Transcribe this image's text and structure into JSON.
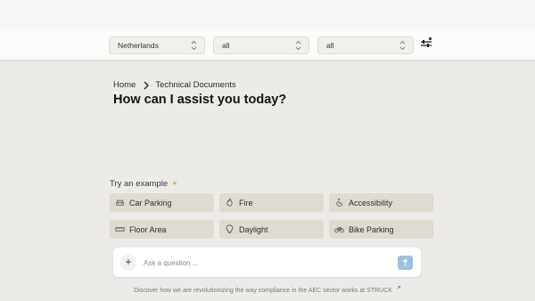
{
  "filters": {
    "country": "Netherlands",
    "filter2": "all",
    "filter3": "all"
  },
  "breadcrumb": {
    "home": "Home",
    "current": "Technical Documents"
  },
  "heading": "How can I assist you today?",
  "examples": {
    "label": "Try an example",
    "items": [
      {
        "label": "Car Parking",
        "icon": "car-icon"
      },
      {
        "label": "Fire",
        "icon": "flame-icon"
      },
      {
        "label": "Accessibility",
        "icon": "wheelchair-icon"
      },
      {
        "label": "Floor Area",
        "icon": "ruler-icon"
      },
      {
        "label": "Daylight",
        "icon": "lightbulb-icon"
      },
      {
        "label": "Bike Parking",
        "icon": "bike-icon"
      }
    ]
  },
  "chat": {
    "placeholder": "Ask a question ..."
  },
  "footer": "Discover how we are revolutionizing the way compliance in the AEC sector works at STRUCK",
  "colors": {
    "send_button": "#9ec2dc",
    "chip_bg": "#dfdbd2",
    "page_bg": "#ecebe7",
    "sparkle": "#e3b74c"
  }
}
